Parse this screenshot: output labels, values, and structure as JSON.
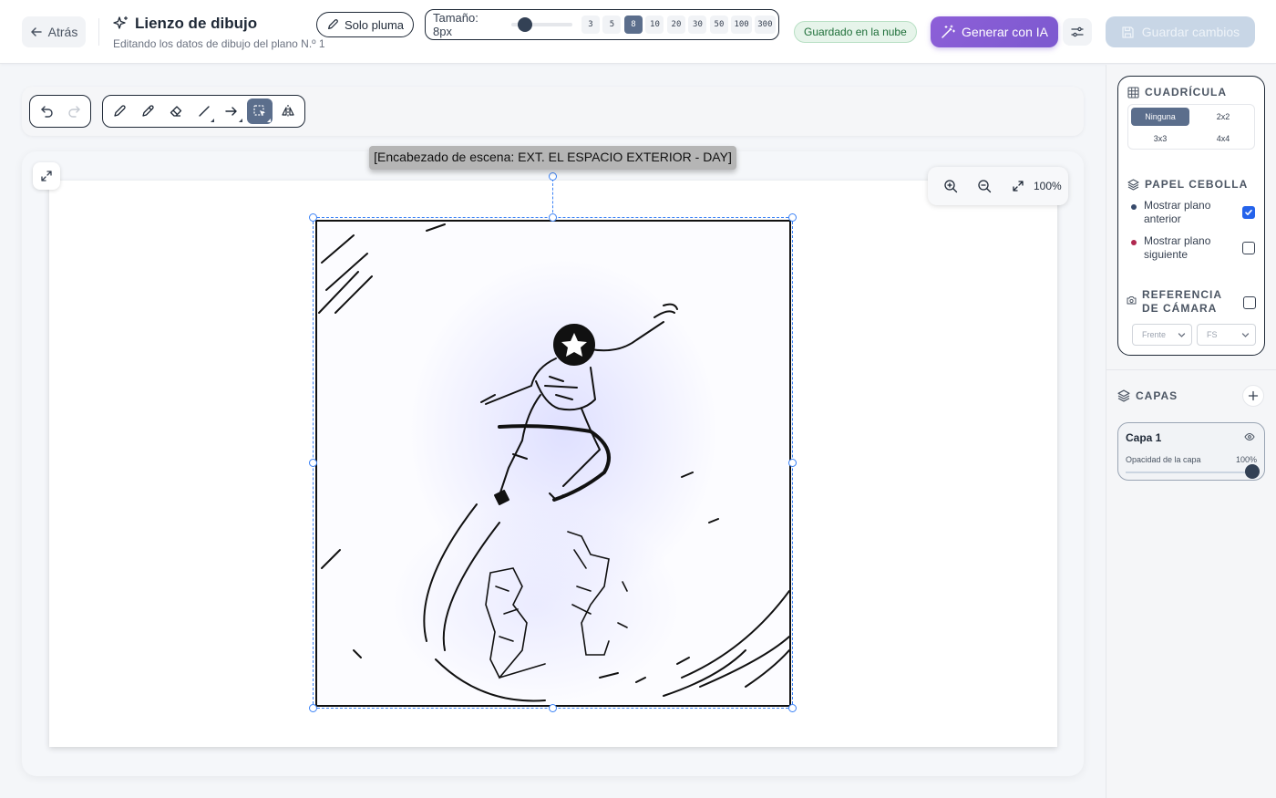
{
  "header": {
    "back_label": "Atrás",
    "title": "Lienzo de dibujo",
    "subtitle": "Editando los datos de dibujo del plano N.º 1",
    "cloud_status": "Guardado en la nube",
    "ai_button": "Generar con IA",
    "save_button": "Guardar cambios"
  },
  "toolbar": {
    "pen_only": "Solo pluma",
    "size_label": "Tamaño: 8px",
    "size_value": 8,
    "size_options": [
      "3",
      "5",
      "8",
      "10",
      "20",
      "30",
      "50",
      "100",
      "300"
    ],
    "active_size": "8",
    "active_tool": "select"
  },
  "canvas": {
    "scene_header": "[Encabezado de escena: EXT. EL ESPACIO EXTERIOR - DAY]",
    "zoom_level": "100%"
  },
  "sidebar": {
    "grid_title": "CUADRÍCULA",
    "grid_options": [
      "Ninguna",
      "2x2",
      "3x3",
      "4x4"
    ],
    "grid_selected": "Ninguna",
    "onion_title": "PAPEL CEBOLLA",
    "onion_prev": "Mostrar plano anterior",
    "onion_prev_checked": true,
    "onion_prev_color": "#374a6b",
    "onion_next": "Mostrar plano siguiente",
    "onion_next_checked": false,
    "onion_next_color": "#b0284f",
    "camera_title": "REFERENCIA DE CÁMARA",
    "camera_checked": false,
    "camera_angle": "Frente",
    "camera_shot": "FS",
    "layers_title": "CAPAS",
    "layer_name": "Capa 1",
    "layer_opacity_label": "Opacidad de la capa",
    "layer_opacity": "100%"
  },
  "colors": {
    "accent": "#8d5fd8",
    "active_chip": "#5b6e8c",
    "save_disabled": "#c8d6e6",
    "checkbox": "#2563eb"
  }
}
